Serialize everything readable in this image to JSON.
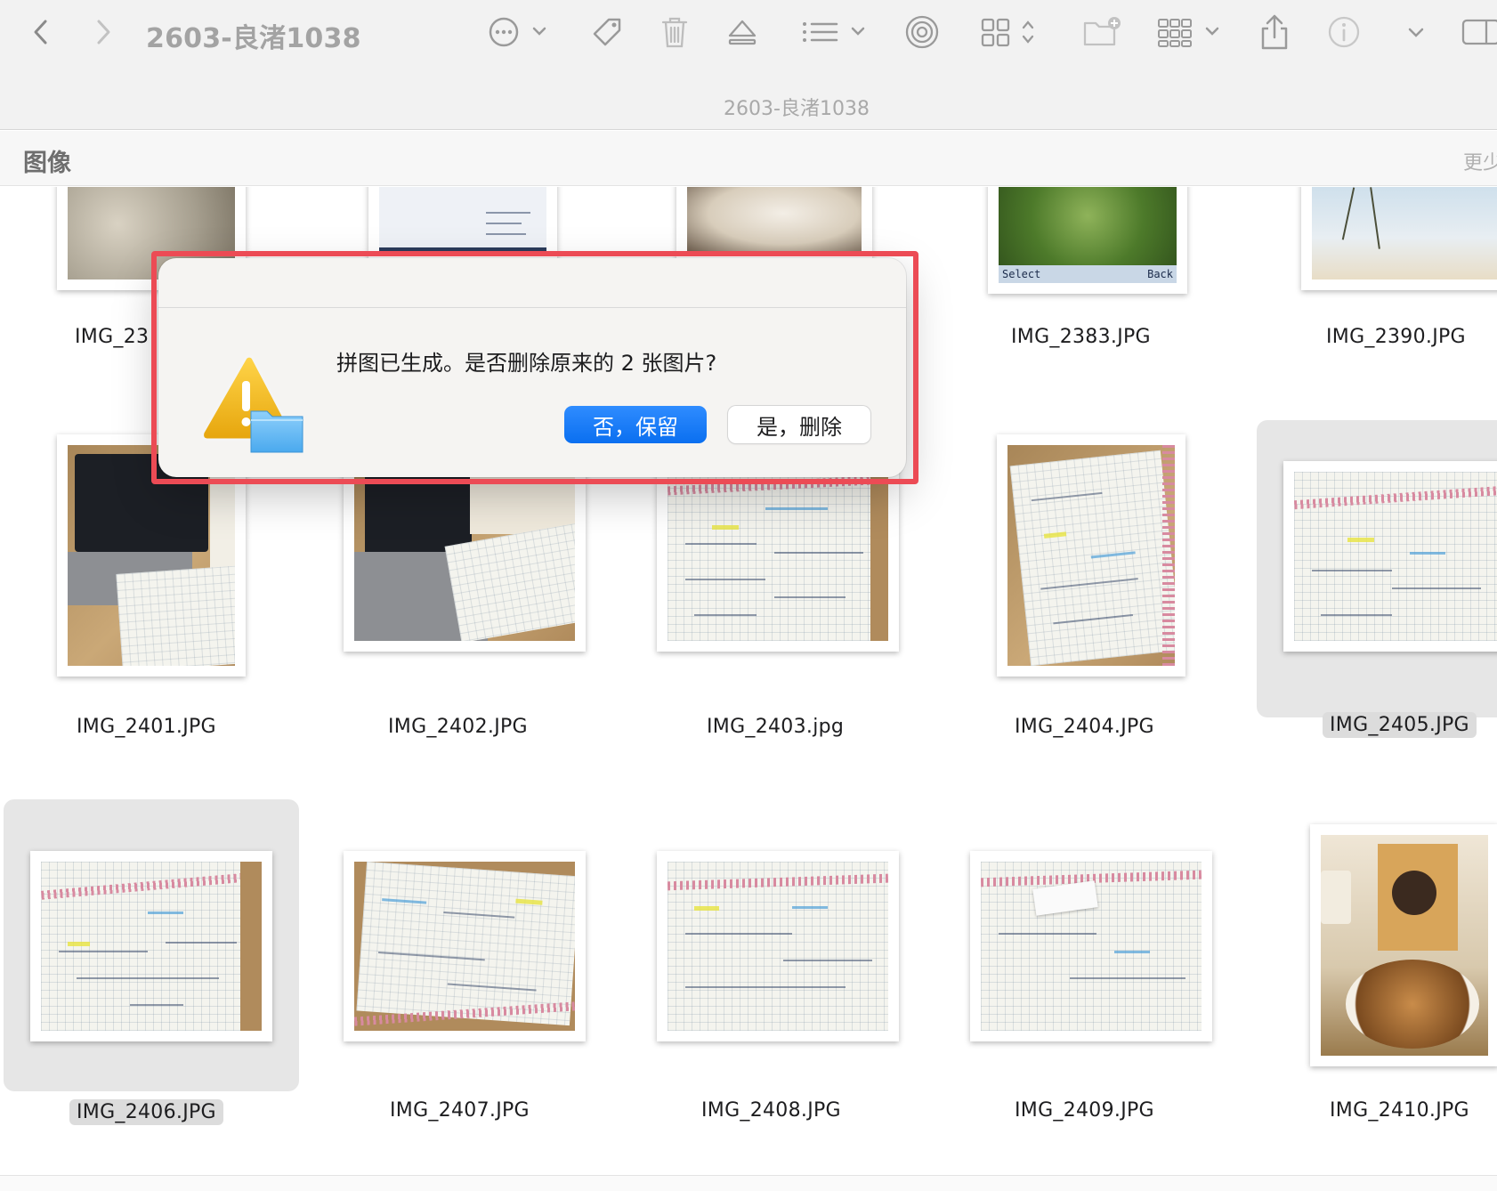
{
  "toolbar": {
    "title": "2603-良渚1038",
    "subtitle": "2603-良渚1038",
    "icons": [
      "back-icon",
      "forward-icon",
      "more-actions-icon",
      "tag-icon",
      "trash-icon",
      "eject-icon",
      "list-view-icon",
      "airdrop-icon",
      "icon-view-icon",
      "new-folder-icon",
      "group-icon",
      "share-icon",
      "info-icon",
      "chevron-down-icon",
      "sidebar-icon"
    ]
  },
  "section": {
    "title": "图像",
    "more_label": "更少"
  },
  "files": [
    {
      "name": "IMG_23",
      "row": 0,
      "col": 0,
      "selected": false
    },
    {
      "name": "",
      "row": 0,
      "col": 1,
      "selected": false
    },
    {
      "name": "",
      "row": 0,
      "col": 2,
      "selected": false
    },
    {
      "name": "IMG_2383.JPG",
      "row": 0,
      "col": 3,
      "selected": false
    },
    {
      "name": "IMG_2390.JPG",
      "row": 0,
      "col": 4,
      "selected": false
    },
    {
      "name": "IMG_2401.JPG",
      "row": 1,
      "col": 0,
      "selected": false
    },
    {
      "name": "IMG_2402.JPG",
      "row": 1,
      "col": 1,
      "selected": false
    },
    {
      "name": "IMG_2403.jpg",
      "row": 1,
      "col": 2,
      "selected": false
    },
    {
      "name": "IMG_2404.JPG",
      "row": 1,
      "col": 3,
      "selected": false
    },
    {
      "name": "IMG_2405.JPG",
      "row": 1,
      "col": 4,
      "selected": true
    },
    {
      "name": "IMG_2406.JPG",
      "row": 2,
      "col": 0,
      "selected": true
    },
    {
      "name": "IMG_2407.JPG",
      "row": 2,
      "col": 1,
      "selected": false
    },
    {
      "name": "IMG_2408.JPG",
      "row": 2,
      "col": 2,
      "selected": false
    },
    {
      "name": "IMG_2409.JPG",
      "row": 2,
      "col": 3,
      "selected": false
    },
    {
      "name": "IMG_2410.JPG",
      "row": 2,
      "col": 4,
      "selected": false
    }
  ],
  "thumb_overlays": {
    "camera_select": "Select",
    "camera_back": "Back"
  },
  "dialog": {
    "message": "拼图已生成。是否删除原来的 2 张图片?",
    "primary_button": "否，保留",
    "secondary_button": "是，删除",
    "icon": "caution-folder-icon",
    "highlight_color": "#ec4b55",
    "primary_color": "#0a6ff0"
  }
}
